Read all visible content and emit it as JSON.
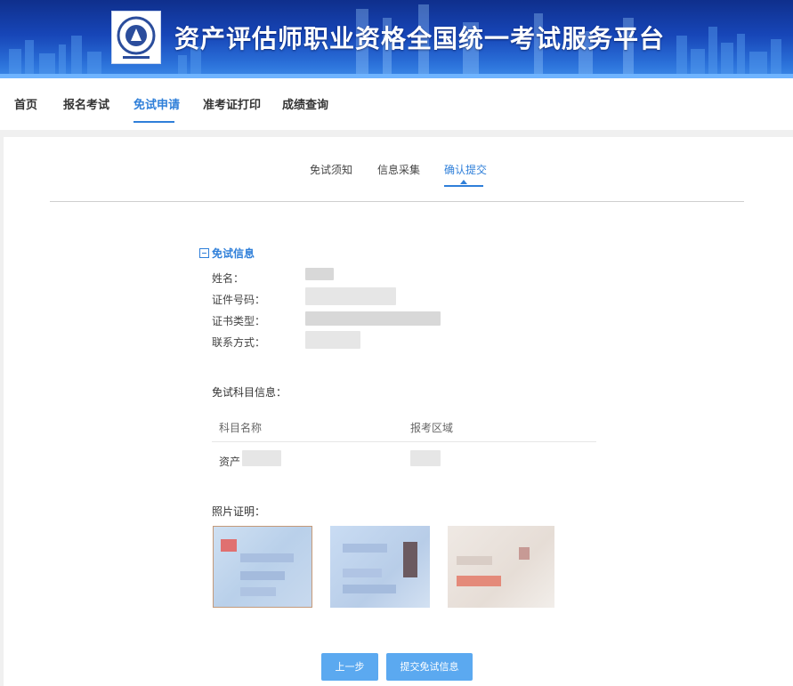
{
  "header": {
    "title": "资产评估师职业资格全国统一考试服务平台",
    "logo_text": "中国资产评估协会 China Appraisal Society"
  },
  "nav": {
    "items": [
      {
        "label": "首页"
      },
      {
        "label": "报名考试"
      },
      {
        "label": "免试申请"
      },
      {
        "label": "准考证打印"
      },
      {
        "label": "成绩查询"
      }
    ],
    "active": "免试申请"
  },
  "steps": {
    "items": [
      {
        "label": "免试须知"
      },
      {
        "label": "信息采集"
      },
      {
        "label": "确认提交"
      }
    ],
    "active": "确认提交"
  },
  "exemption_info": {
    "section_title": "免试信息",
    "fields": [
      {
        "label": "姓名："
      },
      {
        "label": "证件号码："
      },
      {
        "label": "证书类型："
      },
      {
        "label": "联系方式："
      }
    ]
  },
  "subjects": {
    "heading": "免试科目信息：",
    "columns": [
      "科目名称",
      "报考区域"
    ],
    "rows": [
      {
        "name_visible": "资产"
      }
    ]
  },
  "photos": {
    "heading": "照片证明："
  },
  "buttons": {
    "prev_label": "上一步",
    "submit_label": "提交免试信息"
  },
  "colors": {
    "accent": "#2f7fd9",
    "button": "#5ba9f0",
    "banner": "#1746b8"
  }
}
